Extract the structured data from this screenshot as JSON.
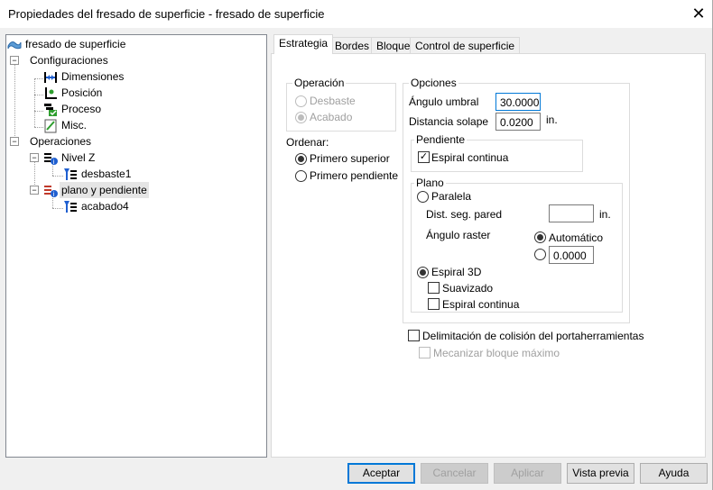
{
  "window": {
    "title": "Propiedades del fresado de superficie - fresado de superficie",
    "close_glyph": "✕"
  },
  "tree": {
    "root": "fresado de superficie",
    "configuraciones": "Configuraciones",
    "dimensiones": "Dimensiones",
    "posicion": "Posición",
    "proceso": "Proceso",
    "misc": "Misc.",
    "operaciones": "Operaciones",
    "nivel_z": "Nivel Z",
    "desbaste1": "desbaste1",
    "plano_pendiente": "plano y pendiente",
    "acabado4": "acabado4",
    "expander_glyph": "−"
  },
  "tabs": [
    "Estrategia",
    "Bordes",
    "Bloque",
    "Control de superficie"
  ],
  "operacion": {
    "label": "Operación",
    "desbaste": "Desbaste",
    "acabado": "Acabado"
  },
  "ordenar": {
    "label": "Ordenar:",
    "primero_superior": "Primero superior",
    "primero_pendiente": "Primero pendiente"
  },
  "opciones": {
    "label": "Opciones",
    "angulo_umbral_label": "Ángulo umbral",
    "angulo_umbral_value": "30.0000",
    "distancia_solape_label": "Distancia solape",
    "distancia_solape_value": "0.0200",
    "unit": "in."
  },
  "pendiente": {
    "label": "Pendiente",
    "espiral_continua": "Espiral continua"
  },
  "plano": {
    "label": "Plano",
    "paralela": "Paralela",
    "dist_seg_pared": "Dist. seg. pared",
    "dist_value": "",
    "unit": "in.",
    "angulo_raster": "Ángulo raster",
    "automatico": "Automático",
    "angle_value": "0.0000",
    "espiral_3d": "Espiral 3D",
    "suavizado": "Suavizado",
    "espiral_continua": "Espiral continua"
  },
  "delimitacion": "Delimitación de colisión del portaherramientas",
  "mecanizar": "Mecanizar bloque máximo",
  "check_glyph": "✓",
  "buttons": {
    "aceptar": "Aceptar",
    "cancelar": "Cancelar",
    "aplicar": "Aplicar",
    "vista_previa": "Vista previa",
    "ayuda": "Ayuda"
  },
  "colors": {
    "accent": "#0078d7",
    "icon_blue": "#1f5fd0",
    "icon_green": "#2e9e2e",
    "icon_red": "#c0392b"
  }
}
